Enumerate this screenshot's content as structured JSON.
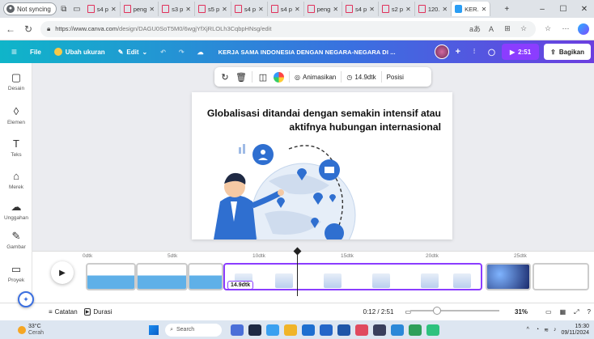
{
  "browser": {
    "profile_label": "Not syncing",
    "tabs": [
      {
        "label": "s4 p"
      },
      {
        "label": "peng"
      },
      {
        "label": "s3 p"
      },
      {
        "label": "s5 p"
      },
      {
        "label": "s4 p"
      },
      {
        "label": "s4 p"
      },
      {
        "label": "peng"
      },
      {
        "label": "s4 p"
      },
      {
        "label": "s2 p"
      },
      {
        "label": "120."
      },
      {
        "label": "KER.",
        "active": true
      }
    ],
    "new_tab": "+",
    "url": "https://www.canva.com/design/DAGU0SoT5M0/6wgjYfXjRLOLh3CqbpHNsg/edit",
    "url_host": "https://www.canva.com",
    "url_path": "/design/DAGU0SoT5M0/6wgjYfXjRLOLh3CqbpHNsg/edit",
    "readaloud": "aあ",
    "aa": "A",
    "window_min": "–",
    "window_max": "☐",
    "window_close": "✕"
  },
  "topbar": {
    "menu_icon": "≡",
    "file": "File",
    "resize": "Ubah ukuran",
    "edit": "Edit",
    "doc_title": "KERJA SAMA INDONESIA DENGAN NEGARA-NEGARA DI ...",
    "plus": "+",
    "present_time": "2:51",
    "share": "Bagikan"
  },
  "sidebar": {
    "items": [
      {
        "label": "Desain",
        "glyph": "▢"
      },
      {
        "label": "Elemen",
        "glyph": "◊"
      },
      {
        "label": "Teks",
        "glyph": "T"
      },
      {
        "label": "Merek",
        "glyph": "⌂"
      },
      {
        "label": "Unggahan",
        "glyph": "☁"
      },
      {
        "label": "Gambar",
        "glyph": "✎"
      },
      {
        "label": "Proyek",
        "glyph": "▭"
      }
    ]
  },
  "context_toolbar": {
    "animate": "Animasikan",
    "duration": "14.9dtk",
    "position": "Posisi"
  },
  "slide": {
    "title": "Globalisasi ditandai dengan semakin intensif atau aktifnya hubungan internasional"
  },
  "timeline": {
    "ticks": [
      "0dtk",
      "5dtk",
      "10dtk",
      "15dtk",
      "20dtk",
      "25dtk"
    ],
    "clip_duration": "14.9dtk"
  },
  "bottombar": {
    "notes": "Catatan",
    "duration": "Durasi",
    "time": "0:12 / 2:51",
    "zoom": "31%"
  },
  "taskbar": {
    "temp": "33°C",
    "weather": "Cerah",
    "search": "Search",
    "clock_time": "15:30",
    "clock_date": "09/11/2024"
  },
  "colors": {
    "brand_purple": "#8b3dff",
    "topbar_start": "#0fb5c9",
    "topbar_end": "#6b3fe0"
  }
}
